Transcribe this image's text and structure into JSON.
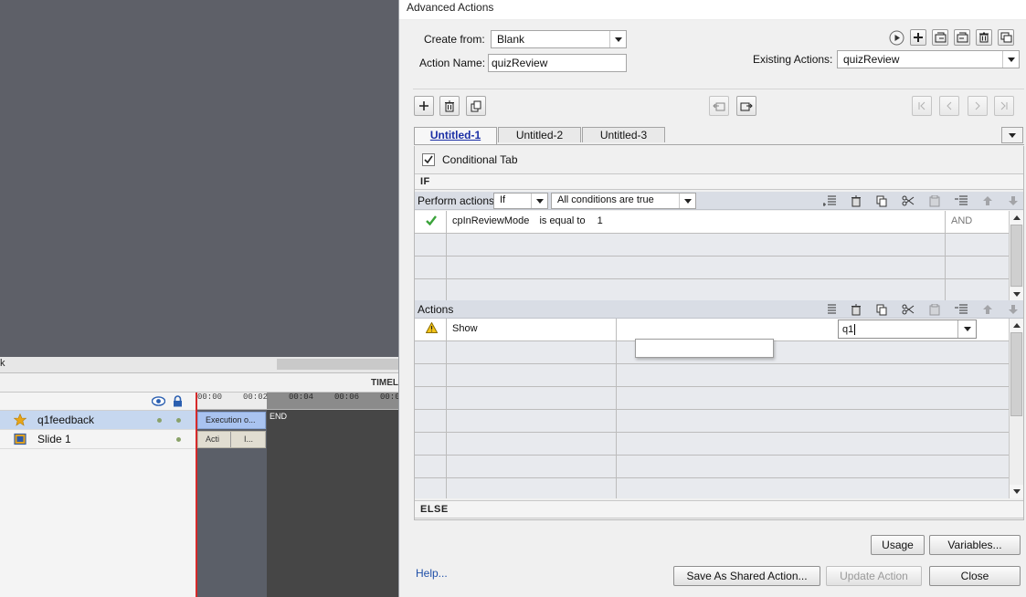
{
  "background": {
    "left_panel_label": "k",
    "timeline_header": "TIMEL",
    "layers": [
      {
        "name": "q1feedback",
        "icon": "star-icon"
      },
      {
        "name": "Slide 1",
        "icon": "slide-icon"
      }
    ],
    "ruler_ticks": [
      "00:00",
      "00:02",
      "00:04",
      "00:06",
      "00:0"
    ],
    "clip_execution": "Execution o...",
    "clip_end": "END",
    "clip_slide_a": "Acti",
    "clip_slide_b": "I..."
  },
  "dialog": {
    "title": "Advanced Actions",
    "create_from_label": "Create from:",
    "create_from_value": "Blank",
    "action_name_label": "Action Name:",
    "action_name_value": "quizReview",
    "existing_actions_label": "Existing Actions:",
    "existing_actions_value": "quizReview",
    "tabs": [
      {
        "label": "Untitled-1",
        "active": true
      },
      {
        "label": "Untitled-2",
        "active": false
      },
      {
        "label": "Untitled-3",
        "active": false
      }
    ],
    "conditional_tab_label": "Conditional Tab",
    "conditional_tab_checked": true,
    "if_label": "IF",
    "perform_actions_label": "Perform actions:",
    "perform_actions_value": "If",
    "conditions_mode_value": "All conditions are true",
    "condition": {
      "variable": "cpInReviewMode",
      "operator": "is equal to",
      "value": "1",
      "joiner": "AND"
    },
    "actions_label": "Actions",
    "action_row": {
      "command": "Show",
      "target_value": "q1"
    },
    "else_label": "ELSE",
    "usage_button": "Usage",
    "variables_button": "Variables...",
    "help_link": "Help...",
    "save_shared_button": "Save As Shared Action...",
    "update_button": "Update Action",
    "close_button": "Close"
  },
  "colors": {
    "active_tab_text": "#1b2fa5",
    "section_toolbar_bg": "#d9dde5",
    "help_link": "#1f4fa8",
    "playhead": "#d62a2a",
    "selected_layer": "#c6d7ef"
  }
}
